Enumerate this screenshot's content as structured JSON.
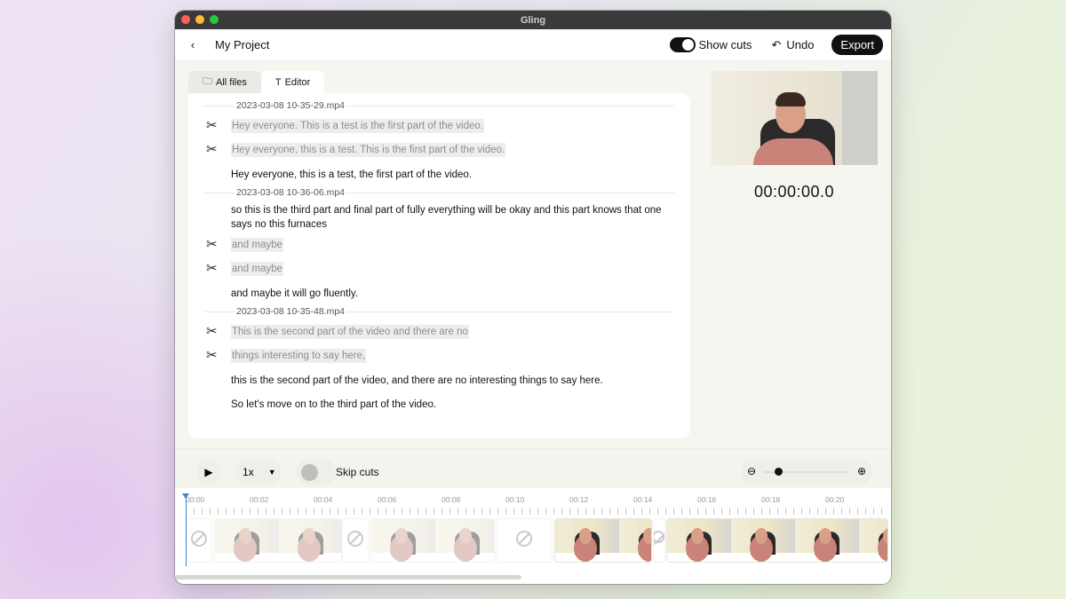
{
  "window": {
    "title": "Gling"
  },
  "appbar": {
    "project": "My Project",
    "show_cuts": "Show cuts",
    "undo": "Undo",
    "export": "Export"
  },
  "tabs": [
    {
      "label": "All files"
    },
    {
      "label": "Editor"
    }
  ],
  "transcript": {
    "files": [
      {
        "name": "2023-03-08 10-35-29.mp4",
        "rows": [
          {
            "cut": true,
            "text": "Hey everyone. This is a test is the first part of the video."
          },
          {
            "cut": true,
            "text": "Hey everyone, this is a test. This is the first part of the video."
          },
          {
            "cut": false,
            "text": "Hey everyone, this is a test, the first part of the video."
          }
        ]
      },
      {
        "name": "2023-03-08 10-36-06.mp4",
        "rows": [
          {
            "cut": false,
            "text": "so this is the third part and final part of fully everything will be okay and this part knows that one says no this furnaces"
          },
          {
            "cut": true,
            "text": "and maybe"
          },
          {
            "cut": true,
            "text": "and maybe"
          },
          {
            "cut": false,
            "text": "and maybe it will go fluently."
          }
        ]
      },
      {
        "name": "2023-03-08 10-35-48.mp4",
        "rows": [
          {
            "cut": true,
            "text": "This is the second part of the video and there are no"
          },
          {
            "cut": true,
            "text": "things interesting to say here,"
          },
          {
            "cut": false,
            "text": "this is the second part of the video, and there are no interesting things to say here."
          },
          {
            "cut": false,
            "text": "So let's move on to the third part of the video."
          }
        ]
      }
    ]
  },
  "preview": {
    "timecode": "00:00:00.0"
  },
  "controls": {
    "speed": "1x",
    "skip_cuts": "Skip cuts"
  },
  "timeline": {
    "ticks": [
      "00:00",
      "00:02",
      "00:04",
      "00:06",
      "00:08",
      "00:10",
      "00:12",
      "00:14",
      "00:16",
      "00:18",
      "00:20"
    ]
  }
}
